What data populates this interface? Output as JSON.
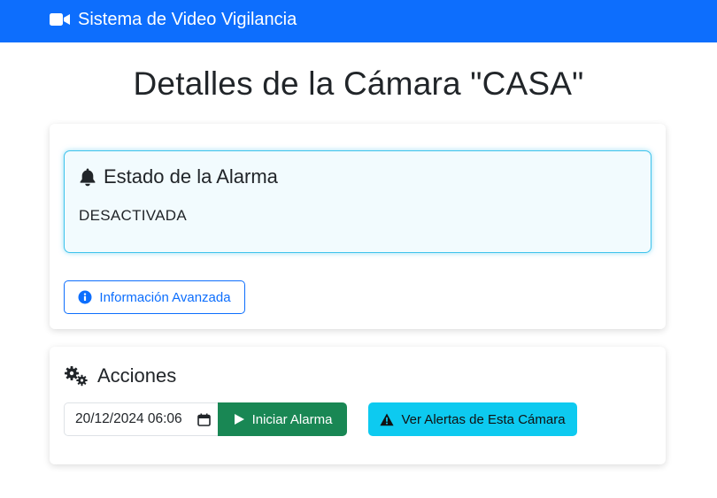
{
  "navbar": {
    "brand_icon": "video-camera-icon",
    "brand": "Sistema de Video Vigilancia",
    "color": "#0d6efd"
  },
  "page": {
    "title": "Detalles de la Cámara \"CASA\""
  },
  "alarm": {
    "icon": "bell-icon",
    "heading": "Estado de la Alarma",
    "status": "DESACTIVADA",
    "info_button_icon": "info-circle-icon",
    "info_button": "Información Avanzada"
  },
  "actions": {
    "icon": "gears-icon",
    "heading": "Acciones",
    "datetime_value": "20/12/2024 06:06",
    "start_button_icon": "play-icon",
    "start_button": "Iniciar Alarma",
    "start_color": "#198754",
    "alerts_button_icon": "warning-triangle-icon",
    "alerts_button": "Ver Alertas de Esta Cámara",
    "alerts_color": "#0dcaf0"
  }
}
